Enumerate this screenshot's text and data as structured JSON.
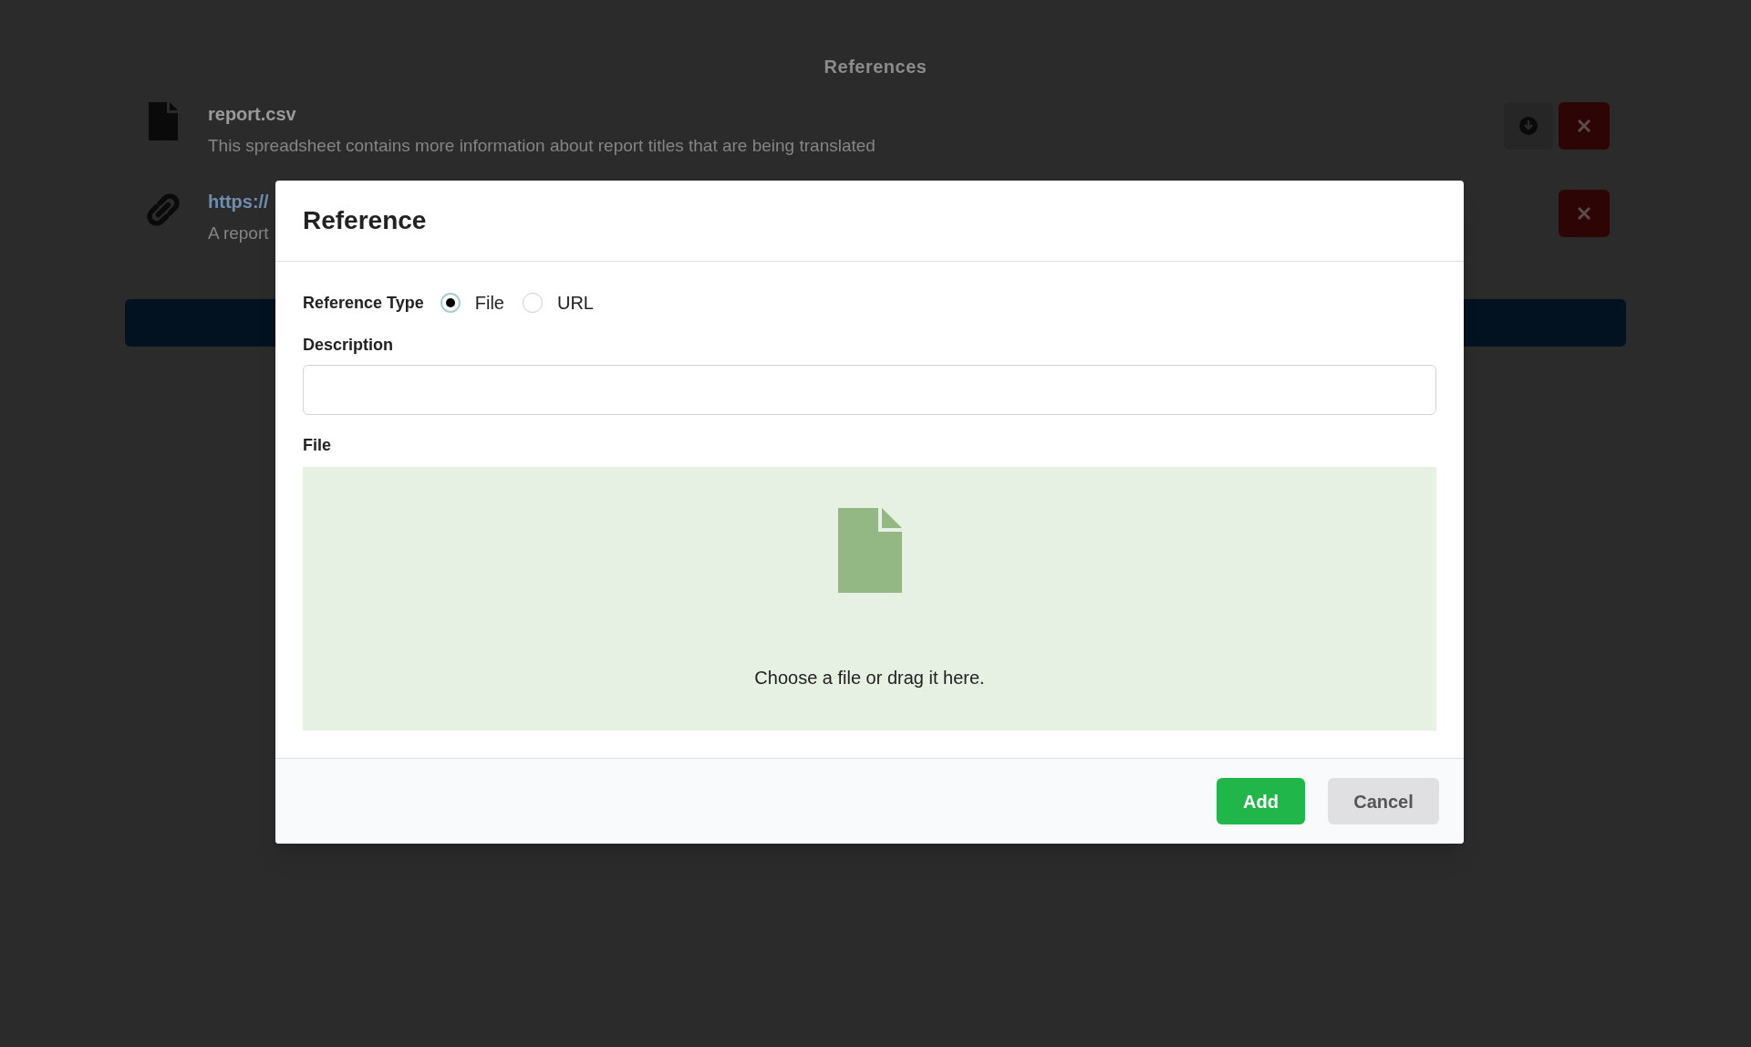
{
  "page": {
    "title": "References",
    "references": [
      {
        "kind": "file",
        "name": "report.csv",
        "description": "This spreadsheet contains more information about report titles that are being translated",
        "downloadable": true
      },
      {
        "kind": "link",
        "name": "https://",
        "description": "A report",
        "downloadable": false
      }
    ]
  },
  "dialog": {
    "title": "Reference",
    "reference_type": {
      "label": "Reference Type",
      "options": [
        {
          "label": "File",
          "selected": true
        },
        {
          "label": "URL",
          "selected": false
        }
      ]
    },
    "description": {
      "label": "Description"
    },
    "file": {
      "label": "File",
      "hint": "Choose a file or drag it here."
    },
    "buttons": [
      {
        "kind": "primary",
        "label": "Add"
      },
      {
        "kind": "secondary",
        "label": "Cancel"
      }
    ]
  }
}
